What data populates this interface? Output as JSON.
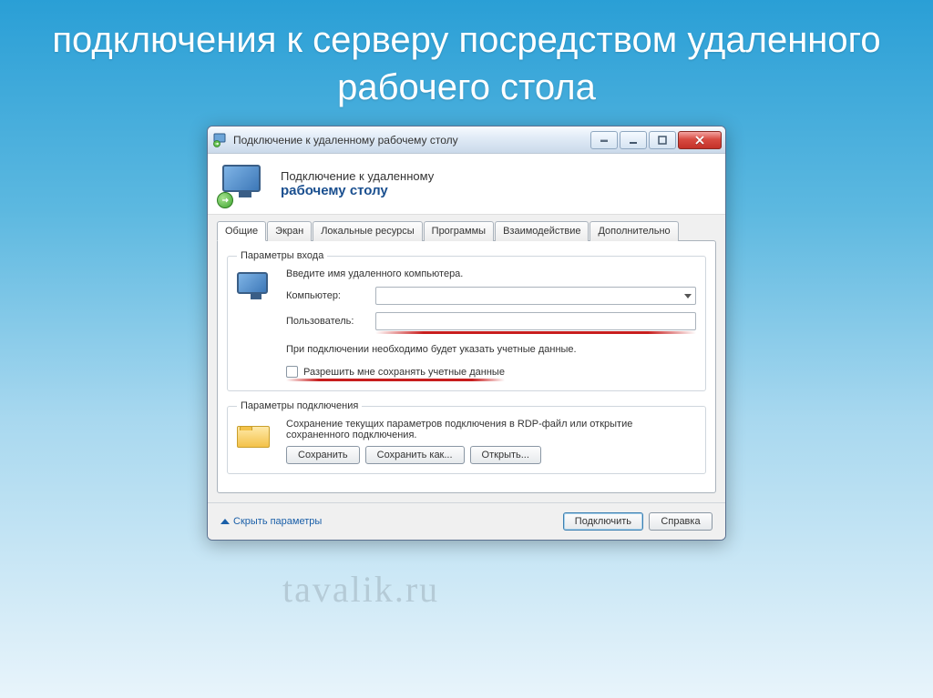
{
  "slide": {
    "title": "подключения к серверу посредством удаленного рабочего стола"
  },
  "window": {
    "title": "Подключение к удаленному рабочему столу",
    "banner_line1": "Подключение к удаленному",
    "banner_line2": "рабочему столу"
  },
  "tabs": [
    {
      "label": "Общие",
      "active": true
    },
    {
      "label": "Экран",
      "active": false
    },
    {
      "label": "Локальные ресурсы",
      "active": false
    },
    {
      "label": "Программы",
      "active": false
    },
    {
      "label": "Взаимодействие",
      "active": false
    },
    {
      "label": "Дополнительно",
      "active": false
    }
  ],
  "login_group": {
    "legend": "Параметры входа",
    "intro": "Введите имя удаленного компьютера.",
    "computer_label": "Компьютер:",
    "computer_value": "",
    "user_label": "Пользователь:",
    "user_value": "",
    "hint": "При подключении необходимо будет указать учетные данные.",
    "checkbox_label": "Разрешить мне сохранять учетные данные"
  },
  "conn_group": {
    "legend": "Параметры подключения",
    "desc": "Сохранение текущих параметров подключения в RDP-файл или открытие сохраненного подключения.",
    "save": "Сохранить",
    "save_as": "Сохранить как...",
    "open": "Открыть..."
  },
  "footer": {
    "hide_params": "Скрыть параметры",
    "connect": "Подключить",
    "help": "Справка"
  },
  "watermark": "tavalik.ru"
}
